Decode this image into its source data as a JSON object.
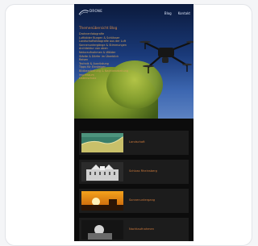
{
  "hero": {
    "logo_text": "DRONE",
    "nav": [
      "Blog",
      "Kontakt"
    ],
    "menu_title": "Themenübersicht Blog",
    "menu_items": [
      "Drohnenfotografie",
      "Luftbilder Burgen & Schlösser",
      "Landschaftsfotografie aus der Luft",
      "Sonnenuntergänge & Stimmungen",
      "Architektur von oben",
      "Naturaufnahmen & Wälder",
      "Städte & Dörfer im Überblick",
      "Reisen",
      "Technik & Ausrüstung",
      "Tipps für Einsteiger",
      "Bildbearbeitung & Nachbearbeitung",
      "Impressum",
      "Datenschutz"
    ]
  },
  "cards": [
    {
      "label": "Landschaft",
      "thumb": "aerial-coast-thumbnail"
    },
    {
      "label": "Schloss Rheinsberg",
      "thumb": "castle-thumbnail"
    },
    {
      "label": "Sonnenuntergang",
      "thumb": "sunset-thumbnail"
    },
    {
      "label": "Nachtaufnahmen",
      "thumb": "night-thumbnail"
    }
  ],
  "colors": {
    "page_bg": "#f4f5f7",
    "phone_bg": "#0c0c0c",
    "card_bg": "#1c1c1c",
    "accent_orange": "#d07b3c",
    "menu_text": "#d4a25e"
  }
}
